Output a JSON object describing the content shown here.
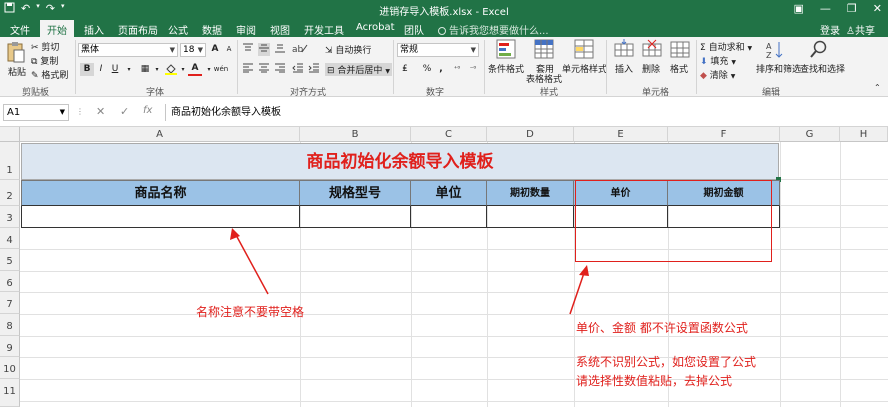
{
  "titlebar": {
    "title": "进销存导入模板.xlsx - Excel",
    "qat": [
      "save-icon",
      "undo-icon",
      "redo-icon",
      "customize-icon"
    ],
    "window_buttons": [
      "ribbon-options-icon",
      "minimize-icon",
      "restore-icon",
      "close-icon"
    ]
  },
  "tabs": [
    {
      "label": "文件"
    },
    {
      "label": "开始",
      "active": true
    },
    {
      "label": "插入"
    },
    {
      "label": "页面布局"
    },
    {
      "label": "公式"
    },
    {
      "label": "数据"
    },
    {
      "label": "审阅"
    },
    {
      "label": "视图"
    },
    {
      "label": "开发工具"
    },
    {
      "label": "Acrobat"
    },
    {
      "label": "团队"
    }
  ],
  "tellme": "告诉我您想要做什么...",
  "login": "登录",
  "share": "共享",
  "ribbon": {
    "clipboard": {
      "paste": "粘贴",
      "cut": "剪切",
      "copy": "复制",
      "format_painter": "格式刷",
      "label": "剪贴板"
    },
    "font": {
      "name": "黑体",
      "size": "18",
      "bold": "B",
      "italic": "I",
      "underline": "U",
      "font_color_letter": "A",
      "grow": "A",
      "shrink": "A",
      "wen": "wén",
      "label": "字体"
    },
    "alignment": {
      "wrap": "自动换行",
      "merge": "合并后居中",
      "label": "对齐方式"
    },
    "number": {
      "format": "常规",
      "percent": "%",
      "comma": ",",
      "label": "数字"
    },
    "styles": {
      "conditional": "条件格式",
      "table_line1": "套用",
      "table_line2": "表格格式",
      "cell_styles": "单元格样式",
      "label": "样式"
    },
    "cells": {
      "insert": "插入",
      "delete": "删除",
      "format": "格式",
      "label": "单元格"
    },
    "editing": {
      "autosum": "自动求和",
      "fill": "填充",
      "clear": "清除",
      "sort": "排序和筛选",
      "find": "查找和选择",
      "label": "编辑"
    }
  },
  "formula_bar": {
    "name_box": "A1",
    "cancel": "✕",
    "enter": "✓",
    "fx": "fx",
    "content": "商品初始化余额导入模板"
  },
  "columns": [
    "A",
    "B",
    "C",
    "D",
    "E",
    "F",
    "G",
    "H"
  ],
  "rows": [
    "1",
    "2",
    "3",
    "4",
    "5",
    "6",
    "7",
    "8",
    "9",
    "10",
    "11"
  ],
  "sheet": {
    "banner": "商品初始化余额导入模板",
    "headers": [
      "商品名称",
      "规格型号",
      "单位",
      "期初数量",
      "单价",
      "期初金额"
    ]
  },
  "annotations": {
    "note_name": "名称注意不要带空格",
    "note_price": "单价、金额  都不许设置函数公式",
    "note_formula1": "系统不识别公式，如您设置了公式",
    "note_formula2": "请选择性数值粘贴，去掉公式",
    "color": "#e0201c"
  },
  "colors": {
    "excel_green": "#217346",
    "header_fill": "#9bc2e6",
    "banner_fill": "#dce6f1",
    "annotation_red": "#e0201c"
  }
}
